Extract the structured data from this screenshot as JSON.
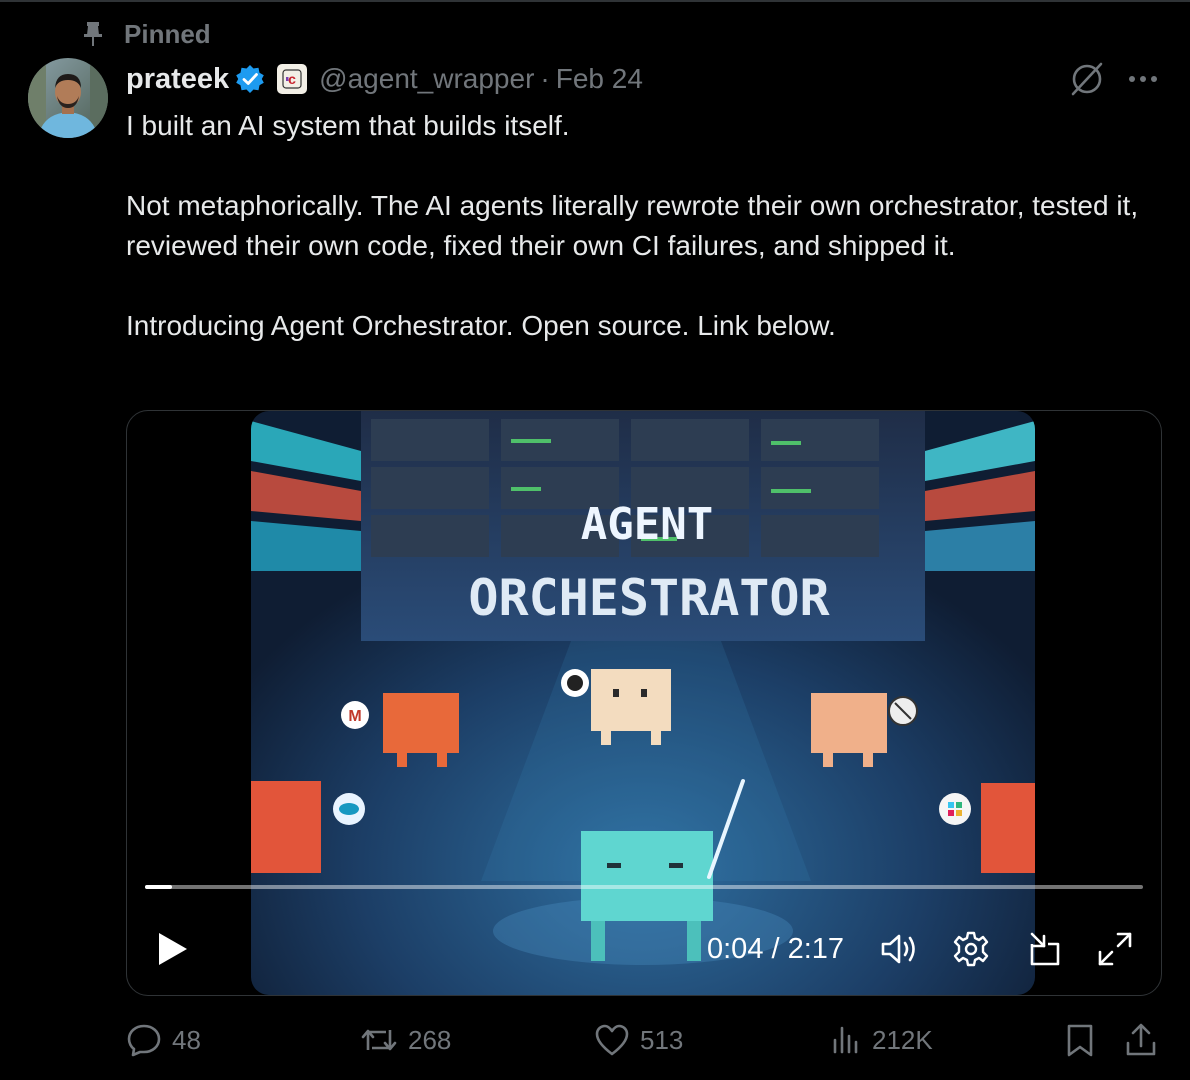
{
  "pinned": {
    "label": "Pinned"
  },
  "author": {
    "name": "prateek",
    "handle": "@agent_wrapper",
    "separator": "·",
    "date": "Feb 24"
  },
  "tweet": {
    "paragraphs": [
      "I built an AI system that builds itself.",
      "Not metaphorically. The AI agents literally rewrote their own orchestrator, tested it, reviewed their own code, fixed their own CI failures, and shipped it.",
      "Introducing Agent Orchestrator. Open source. Link below."
    ]
  },
  "video": {
    "title_line1": "AGENT",
    "title_line2": "ORCHESTRATOR",
    "time": "0:04 / 2:17",
    "progress_fraction": 0.027,
    "controls": [
      "play-icon",
      "volume-icon",
      "settings-icon",
      "pip-icon",
      "fullscreen-icon"
    ]
  },
  "actions": {
    "replies": "48",
    "reposts": "268",
    "likes": "513",
    "views": "212K"
  },
  "colors": {
    "background": "#000000",
    "text": "#e7e9ea",
    "muted": "#71767b",
    "verified": "#1d9bf0",
    "border": "#2f3336"
  }
}
